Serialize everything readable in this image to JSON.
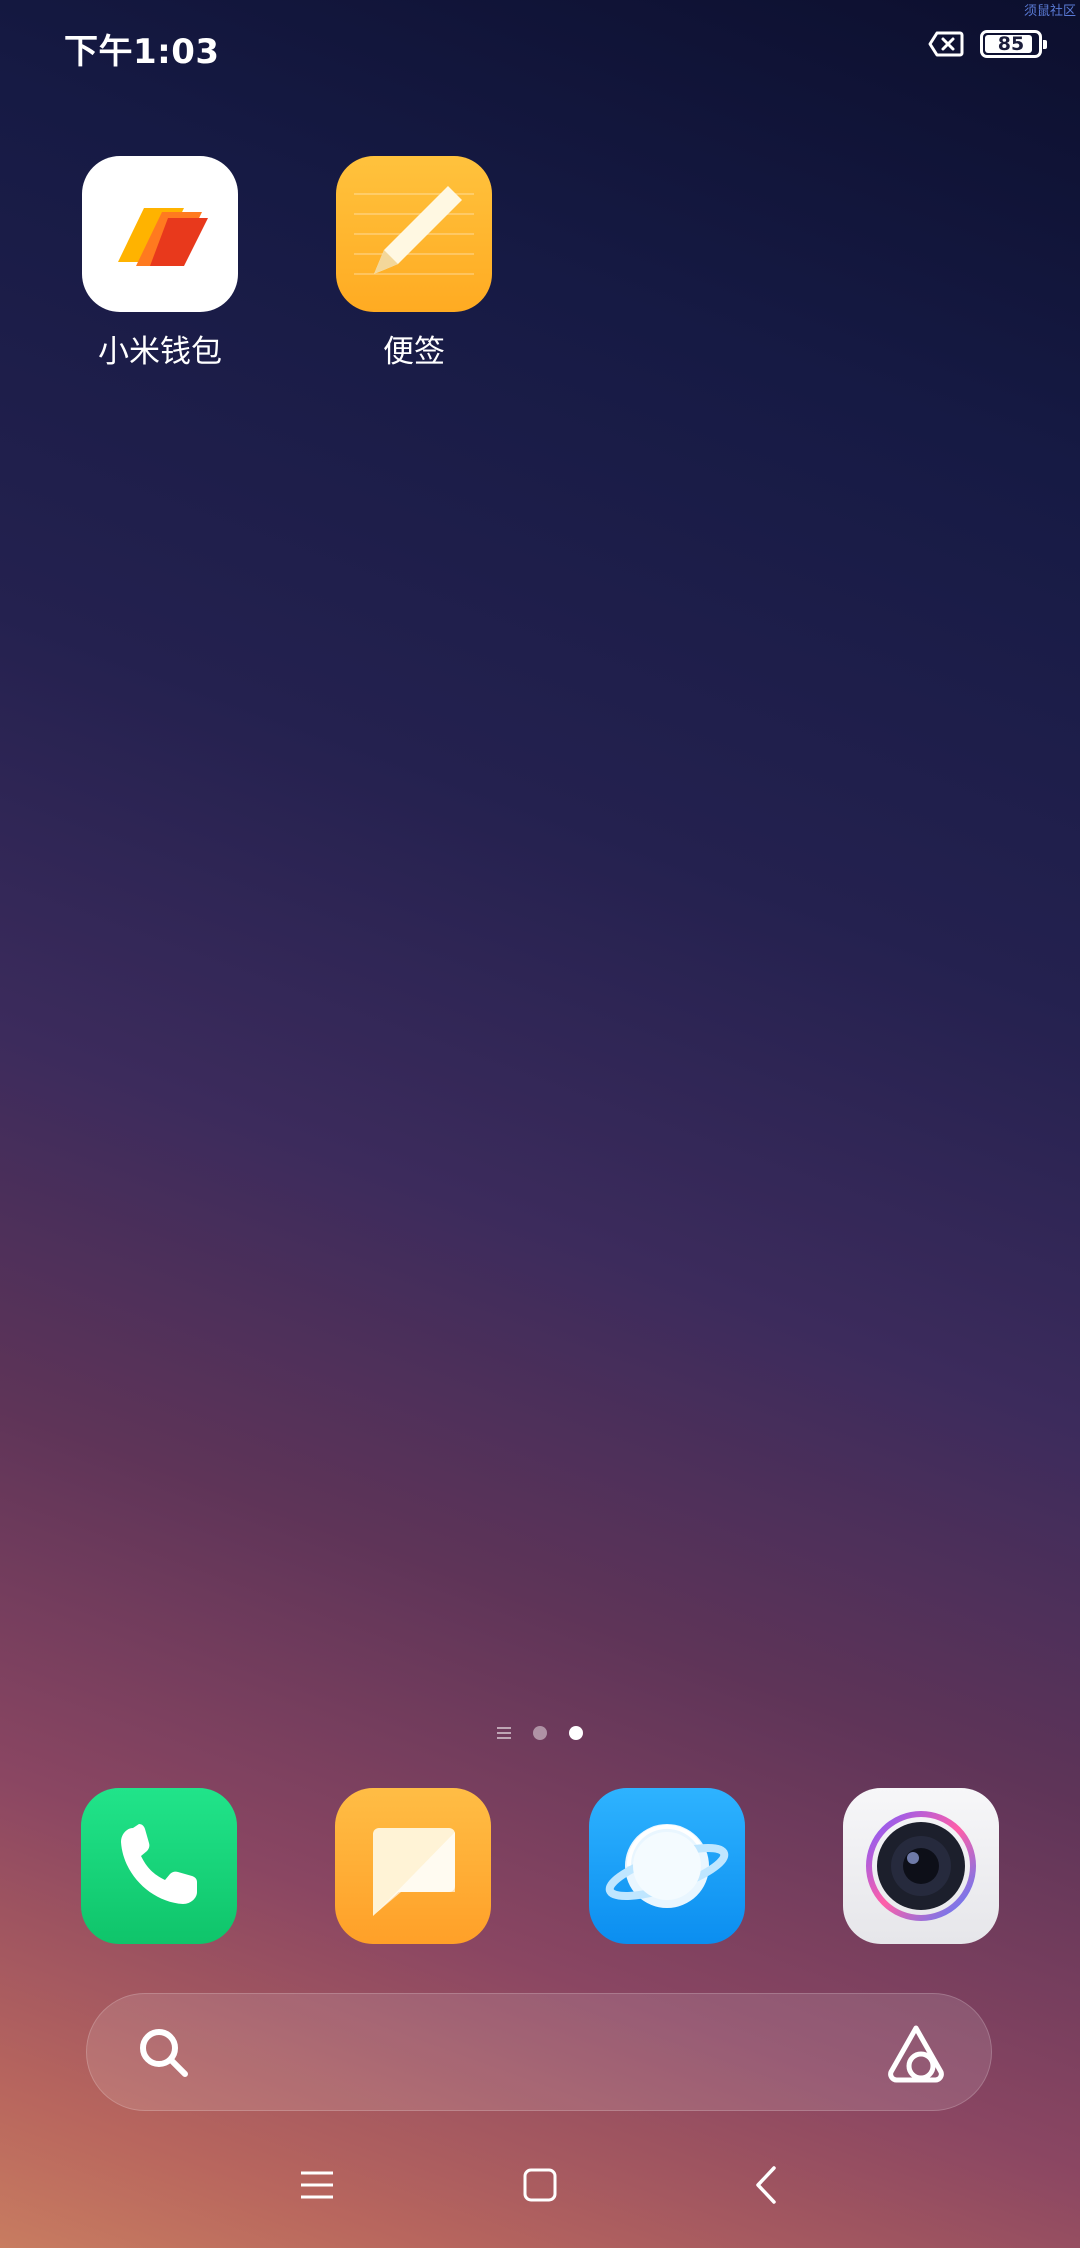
{
  "status_bar": {
    "time": "下午1:03",
    "battery_level": "85",
    "sim_icon": "no-sim-icon",
    "corner_text": "须鼠社区"
  },
  "home_apps": [
    {
      "label": "小米钱包",
      "icon": "mi-wallet-icon"
    },
    {
      "label": "便签",
      "icon": "notes-icon"
    }
  ],
  "page_indicator": {
    "pages": 2,
    "active_page": 2,
    "has_feed_page": true
  },
  "dock": [
    {
      "name": "phone",
      "icon": "phone-icon",
      "color": "#1ed67d"
    },
    {
      "name": "messages",
      "icon": "message-icon",
      "color": "#ffab38"
    },
    {
      "name": "browser",
      "icon": "browser-icon",
      "color": "#1aa3ff"
    },
    {
      "name": "camera",
      "icon": "camera-icon",
      "color": "#f1f1f3"
    }
  ],
  "search_bar": {
    "search_icon": "search-icon",
    "assistant_icon": "ai-assistant-icon"
  },
  "nav_bar": {
    "menu_icon": "menu-icon",
    "home_icon": "home-icon",
    "back_icon": "back-icon"
  }
}
